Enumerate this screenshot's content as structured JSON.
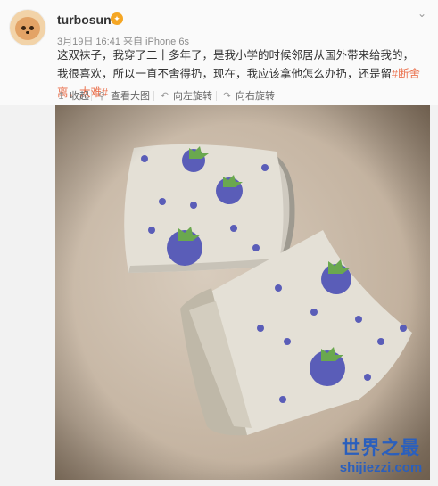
{
  "post": {
    "username": "turbosun",
    "badge": "✦",
    "meta": "3月19日 16:41 来自 iPhone 6s",
    "text_main": "这双袜子，我穿了二十多年了，是我小学的时候邻居从国外带来给我的，我很喜欢，所以一直不舍得扔，现在，我应该拿他怎么办扔，还是留",
    "tags": "#断舍离，太难#"
  },
  "actions": [
    {
      "label": "收起",
      "icon": "collapse-icon"
    },
    {
      "label": "查看大图",
      "icon": "zoom-icon"
    },
    {
      "label": "向左旋转",
      "icon": "rotate-left-icon"
    },
    {
      "label": "向右旋转",
      "icon": "rotate-right-icon"
    }
  ],
  "watermark": {
    "line1": "世界之最",
    "line2": "shijiezzi.com"
  },
  "colors": {
    "tag": "#eb7350",
    "watermark": "#2a5fbd",
    "sock": "#e4e0d6",
    "strawberry": "#5a5db8",
    "leaf": "#6aa84f",
    "floor": "#c9b9a6"
  }
}
